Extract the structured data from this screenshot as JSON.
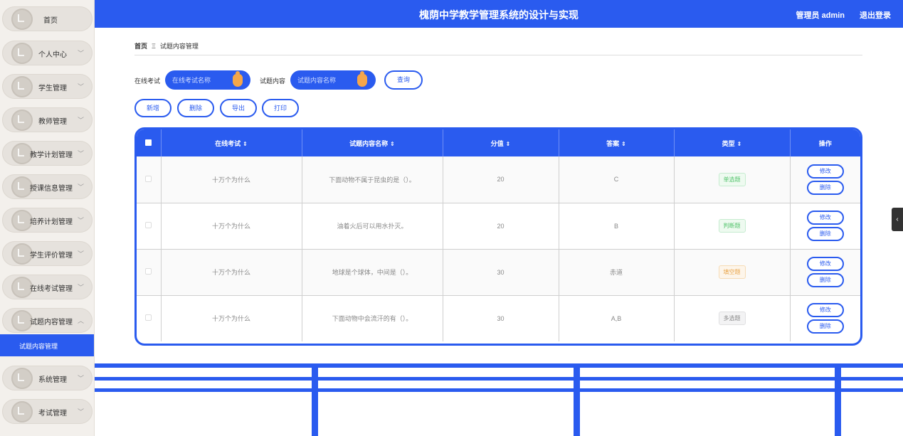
{
  "app": {
    "title": "槐荫中学教学管理系统的设计与实现",
    "user_label": "管理员 admin",
    "logout_label": "退出登录"
  },
  "sidebar": {
    "items": [
      {
        "label": "首页",
        "expandable": false
      },
      {
        "label": "个人中心",
        "expandable": true
      },
      {
        "label": "学生管理",
        "expandable": true
      },
      {
        "label": "教师管理",
        "expandable": true
      },
      {
        "label": "教学计划管理",
        "expandable": true
      },
      {
        "label": "授课信息管理",
        "expandable": true
      },
      {
        "label": "培养计划管理",
        "expandable": true
      },
      {
        "label": "学生评价管理",
        "expandable": true
      },
      {
        "label": "在线考试管理",
        "expandable": true
      },
      {
        "label": "试题内容管理",
        "expandable": true,
        "expanded": true
      },
      {
        "label": "系统管理",
        "expandable": true
      },
      {
        "label": "考试管理",
        "expandable": true
      }
    ],
    "active_subitem": "试题内容管理"
  },
  "breadcrumb": {
    "home": "首页",
    "separator": "Ξ",
    "current": "试题内容管理"
  },
  "search": {
    "exam_label": "在线考试",
    "exam_placeholder": "在线考试名称",
    "content_label": "试题内容",
    "content_placeholder": "试题内容名称",
    "query_button": "查询"
  },
  "actions": {
    "add": "新增",
    "delete": "删除",
    "export": "导出",
    "print": "打印"
  },
  "table": {
    "columns": [
      "在线考试",
      "试题内容名称",
      "分值",
      "答案",
      "类型",
      "操作"
    ],
    "sort_icon": "⇕",
    "rows": [
      {
        "exam": "十万个为什么",
        "name": "下面动物不属于昆虫的是（）。",
        "score": "20",
        "answer": "C",
        "type": "单选题",
        "type_color": "green"
      },
      {
        "exam": "十万个为什么",
        "name": "油着火后可以用水扑灭。",
        "score": "20",
        "answer": "B",
        "type": "判断题",
        "type_color": "green"
      },
      {
        "exam": "十万个为什么",
        "name": "地球是个球体，中间是（）。",
        "score": "30",
        "answer": "赤道",
        "type": "填空题",
        "type_color": "orange"
      },
      {
        "exam": "十万个为什么",
        "name": "下面动物中会流汗的有（）。",
        "score": "30",
        "answer": "A,B",
        "type": "多选题",
        "type_color": "gray"
      }
    ],
    "edit_label": "修改",
    "delete_label": "删除"
  },
  "colors": {
    "primary": "#2a5bef",
    "knob": "#f5a64a"
  }
}
